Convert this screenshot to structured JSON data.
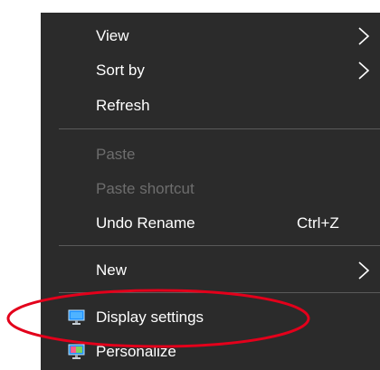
{
  "menu": {
    "items": {
      "view": {
        "label": "View",
        "icon": "chevron-right-icon"
      },
      "sort_by": {
        "label": "Sort by",
        "icon": "chevron-right-icon"
      },
      "refresh": {
        "label": "Refresh"
      },
      "paste": {
        "label": "Paste",
        "disabled": true
      },
      "paste_shortcut": {
        "label": "Paste shortcut",
        "disabled": true
      },
      "undo_rename": {
        "label": "Undo Rename",
        "shortcut": "Ctrl+Z"
      },
      "new": {
        "label": "New",
        "icon": "chevron-right-icon"
      },
      "display_settings": {
        "label": "Display settings",
        "icon": "monitor-icon"
      },
      "personalize": {
        "label": "Personalize",
        "icon": "personalize-icon"
      }
    }
  },
  "colors": {
    "menu_background": "#2b2b2b",
    "text": "#ffffff",
    "disabled_text": "#6d6d6d",
    "separator": "#5a5a5a",
    "annotation_ellipse": "#e3001b"
  }
}
